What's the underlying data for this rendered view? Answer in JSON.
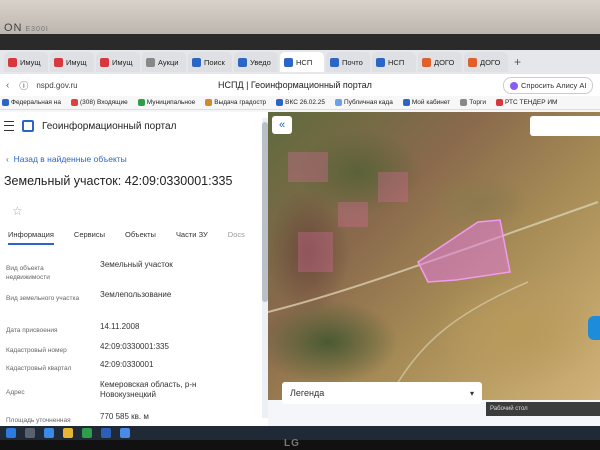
{
  "monitor": {
    "brand": "ON",
    "model": "E300I"
  },
  "browser": {
    "tabs": [
      {
        "label": "Имущ",
        "color": "#d9363e",
        "active": false
      },
      {
        "label": "Имущ",
        "color": "#d9363e",
        "active": false
      },
      {
        "label": "Имущ",
        "color": "#d9363e",
        "active": false
      },
      {
        "label": "Аукци",
        "color": "#888888",
        "active": false
      },
      {
        "label": "Поиск",
        "color": "#2b66c7",
        "active": false
      },
      {
        "label": "Уведо",
        "color": "#2b66c7",
        "active": false
      },
      {
        "label": "НСП",
        "color": "#2b66c7",
        "active": true
      },
      {
        "label": "Почто",
        "color": "#2b66c7",
        "active": false
      },
      {
        "label": "НСП",
        "color": "#2b66c7",
        "active": false
      },
      {
        "label": "ДОГО",
        "color": "#e0602a",
        "active": false
      },
      {
        "label": "ДОГО",
        "color": "#e0602a",
        "active": false
      }
    ],
    "url": "nspd.gov.ru",
    "page_title": "НСПД | Геоинформационный портал",
    "alice_label": "Спросить Алису AI",
    "bookmarks": [
      "Федеральная на",
      "(308) Входящие",
      "Муниципальное",
      "Выдача градостр",
      "ВКС 26.02.25",
      "Публичная када",
      "Мой кабинет",
      "Торги",
      "РТС ТЕНДЕР ИМ"
    ]
  },
  "portal": {
    "title": "Геоинформационный портал",
    "back_link": "Назад в найденные объекты",
    "object_title": "Земельный участок: 42:09:0330001:335",
    "tabs": [
      "Информация",
      "Сервисы",
      "Объекты",
      "Части ЗУ",
      "Docs"
    ],
    "fields": [
      {
        "label": "Вид объекта недвижимости",
        "value": "Земельный участок"
      },
      {
        "label": "Вид земельного участка",
        "value": "Землепользование"
      },
      {
        "label": "Дата присвоения",
        "value": "14.11.2008"
      },
      {
        "label": "Кадастровый номер",
        "value": "42:09:0330001:335"
      },
      {
        "label": "Кадастровый квартал",
        "value": "42:09:0330001"
      },
      {
        "label": "Адрес",
        "value": "Кемеровская область, р-н Новокузнецкий"
      },
      {
        "label": "Площадь уточненная",
        "value": "770 585 кв. м"
      }
    ],
    "legend_label": "Легенда"
  },
  "taskbar": {
    "status_text": "Рабочий стол",
    "monitor_logo": "LG"
  }
}
